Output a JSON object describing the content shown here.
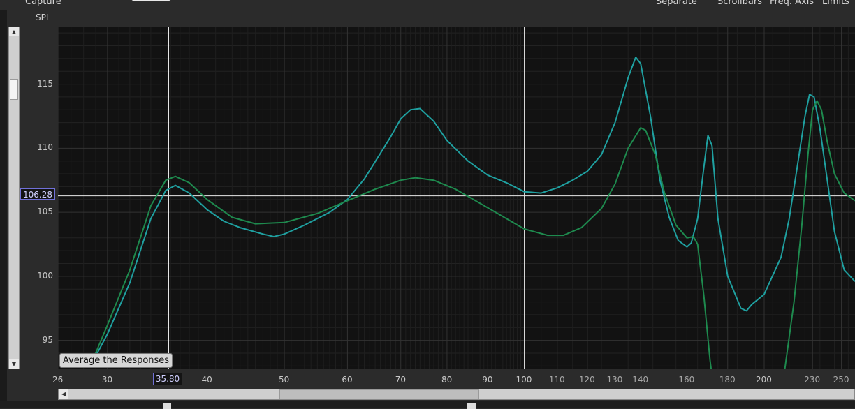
{
  "toolbar": {
    "capture_label": "Capture",
    "separate_label": "Separate",
    "scrollbars_label": "Scrollbars",
    "freq_axis_label": "Freq. Axis",
    "limits_label": "Limits"
  },
  "graph": {
    "cursor_spl": "106.28",
    "cursor_freq": "35.80",
    "average_button_label": "Average the Responses"
  },
  "colors": {
    "teal_trace": "#1fa0a0",
    "green_trace": "#1e8a4e",
    "background": "#121212",
    "grid": "#2c2c2c",
    "cursor": "#e8e8e8"
  },
  "chart_data": {
    "type": "line",
    "title": "",
    "ylabel": "SPL",
    "xlabel": "",
    "x_scale": "log",
    "xlim": [
      26,
      260
    ],
    "ylim": [
      92.8,
      119.5
    ],
    "y_ticks": [
      95,
      100,
      105,
      110,
      115
    ],
    "x_ticks": [
      26,
      30,
      40,
      50,
      60,
      70,
      80,
      90,
      100,
      110,
      120,
      130,
      140,
      160,
      180,
      200,
      230,
      250
    ],
    "grid": true,
    "cursor": {
      "x": 35.8,
      "y": 106.28
    },
    "series": [
      {
        "color": "#1fa0a0",
        "points": [
          [
            28.5,
            92.9
          ],
          [
            30,
            95.5
          ],
          [
            32,
            99.5
          ],
          [
            34,
            104.5
          ],
          [
            35.5,
            106.7
          ],
          [
            36.5,
            107.1
          ],
          [
            38,
            106.5
          ],
          [
            40,
            105.2
          ],
          [
            42,
            104.3
          ],
          [
            44,
            103.8
          ],
          [
            47,
            103.3
          ],
          [
            48.5,
            103.1
          ],
          [
            50,
            103.3
          ],
          [
            53,
            104.0
          ],
          [
            57,
            105.0
          ],
          [
            60,
            106.0
          ],
          [
            63,
            107.6
          ],
          [
            66,
            109.6
          ],
          [
            68,
            110.9
          ],
          [
            70,
            112.3
          ],
          [
            72,
            113.0
          ],
          [
            74,
            113.1
          ],
          [
            77,
            112.1
          ],
          [
            80,
            110.6
          ],
          [
            85,
            109.0
          ],
          [
            90,
            107.9
          ],
          [
            95,
            107.3
          ],
          [
            100,
            106.6
          ],
          [
            105,
            106.5
          ],
          [
            110,
            106.9
          ],
          [
            115,
            107.5
          ],
          [
            120,
            108.2
          ],
          [
            125,
            109.5
          ],
          [
            130,
            112.0
          ],
          [
            135,
            115.5
          ],
          [
            138,
            117.1
          ],
          [
            140,
            116.6
          ],
          [
            144,
            112.5
          ],
          [
            148,
            107.5
          ],
          [
            152,
            104.6
          ],
          [
            156,
            102.8
          ],
          [
            160,
            102.3
          ],
          [
            162,
            102.6
          ],
          [
            165,
            104.5
          ],
          [
            168,
            108.5
          ],
          [
            170,
            111.0
          ],
          [
            172,
            110.2
          ],
          [
            175,
            104.5
          ],
          [
            180,
            100.0
          ],
          [
            187,
            97.5
          ],
          [
            190,
            97.3
          ],
          [
            193,
            97.8
          ],
          [
            200,
            98.6
          ],
          [
            210,
            101.5
          ],
          [
            215,
            104.5
          ],
          [
            220,
            108.5
          ],
          [
            225,
            112.5
          ],
          [
            228,
            114.2
          ],
          [
            231,
            114.0
          ],
          [
            235,
            111.5
          ],
          [
            240,
            107.5
          ],
          [
            245,
            103.5
          ],
          [
            252,
            100.5
          ],
          [
            260,
            99.6
          ]
        ]
      },
      {
        "color": "#1e8a4e",
        "points": [
          [
            28.5,
            92.9
          ],
          [
            30,
            96.2
          ],
          [
            32,
            100.5
          ],
          [
            34,
            105.5
          ],
          [
            35.5,
            107.5
          ],
          [
            36.5,
            107.8
          ],
          [
            38,
            107.3
          ],
          [
            40,
            106.0
          ],
          [
            43,
            104.6
          ],
          [
            46,
            104.1
          ],
          [
            50,
            104.2
          ],
          [
            55,
            104.9
          ],
          [
            60,
            105.9
          ],
          [
            65,
            106.8
          ],
          [
            70,
            107.5
          ],
          [
            73,
            107.7
          ],
          [
            77,
            107.5
          ],
          [
            82,
            106.8
          ],
          [
            88,
            105.7
          ],
          [
            95,
            104.5
          ],
          [
            100,
            103.7
          ],
          [
            107,
            103.2
          ],
          [
            112,
            103.2
          ],
          [
            118,
            103.8
          ],
          [
            125,
            105.3
          ],
          [
            130,
            107.2
          ],
          [
            135,
            110.0
          ],
          [
            140,
            111.6
          ],
          [
            142,
            111.4
          ],
          [
            146,
            109.5
          ],
          [
            150,
            106.5
          ],
          [
            155,
            104.0
          ],
          [
            160,
            103.0
          ],
          [
            163,
            103.1
          ],
          [
            165,
            102.5
          ],
          [
            168,
            98.5
          ],
          [
            171,
            93.5
          ],
          [
            173,
            91.0
          ],
          [
            205,
            91.0
          ],
          [
            212,
            92.5
          ],
          [
            218,
            98.0
          ],
          [
            223,
            104.0
          ],
          [
            227,
            109.5
          ],
          [
            230,
            113.0
          ],
          [
            233,
            113.7
          ],
          [
            236,
            113.0
          ],
          [
            240,
            110.5
          ],
          [
            245,
            108.0
          ],
          [
            252,
            106.5
          ],
          [
            260,
            105.9
          ]
        ]
      }
    ]
  }
}
